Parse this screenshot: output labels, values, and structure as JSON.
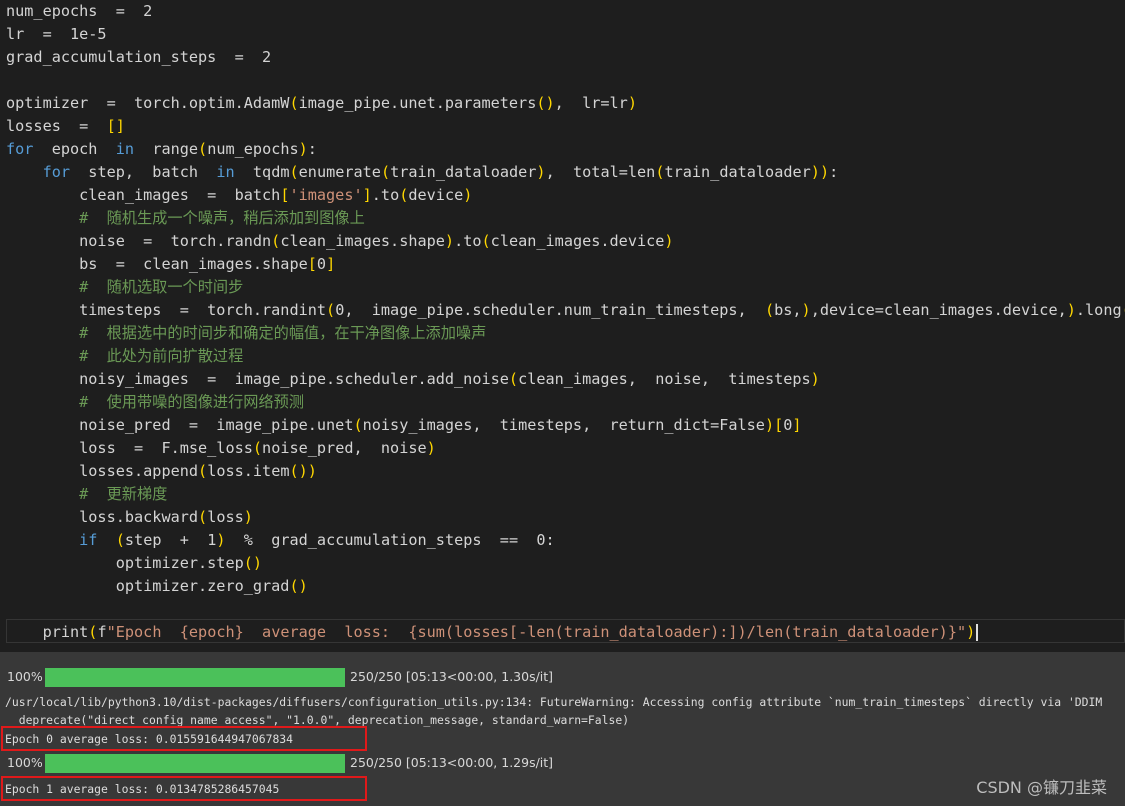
{
  "code": {
    "lines": [
      "num_epochs  =  2",
      "lr  =  1e-5",
      "grad_accumulation_steps  =  2",
      "",
      "optimizer  =  torch.optim.AdamW(image_pipe.unet.parameters(),  lr=lr)",
      "losses  =  []",
      "for  epoch  in  range(num_epochs):",
      "    for  step,  batch  in  tqdm(enumerate(train_dataloader),  total=len(train_dataloader)):",
      "        clean_images  =  batch['images'].to(device)",
      "        #  随机生成一个噪声，稍后添加到图像上",
      "        noise  =  torch.randn(clean_images.shape).to(clean_images.device)",
      "        bs  =  clean_images.shape[0]",
      "        #  随机选取一个时间步",
      "        timesteps  =  torch.randint(0,  image_pipe.scheduler.num_train_timesteps,  (bs,),device=clean_images.device,).long()",
      "        #  根据选中的时间步和确定的幅值，在干净图像上添加噪声",
      "        #  此处为前向扩散过程",
      "        noisy_images  =  image_pipe.scheduler.add_noise(clean_images,  noise,  timesteps)",
      "        #  使用带噪的图像进行网络预测",
      "        noise_pred  =  image_pipe.unet(noisy_images,  timesteps,  return_dict=False)[0]",
      "        loss  =  F.mse_loss(noise_pred,  noise)",
      "        losses.append(loss.item())",
      "        #  更新梯度",
      "        loss.backward(loss)",
      "        if  (step  +  1)  %  grad_accumulation_steps  ==  0:",
      "            optimizer.step()",
      "            optimizer.zero_grad()",
      "",
      "    print(f\"Epoch  {epoch}  average  loss:  {sum(losses[-len(train_dataloader):])/len(train_dataloader)}\")"
    ]
  },
  "output": {
    "progress_1": {
      "percent_label": "100%",
      "fraction": 1.0,
      "stats": "250/250 [05:13<00:00, 1.30s/it]"
    },
    "warning_line_1": "/usr/local/lib/python3.10/dist-packages/diffusers/configuration_utils.py:134: FutureWarning: Accessing config attribute `num_train_timesteps` directly via 'DDIM",
    "warning_line_2": "  deprecate(\"direct config name access\", \"1.0.0\", deprecation_message, standard_warn=False)",
    "epoch_0": "Epoch 0 average loss: 0.015591644947067834",
    "progress_2": {
      "percent_label": "100%",
      "fraction": 1.0,
      "stats": "250/250 [05:13<00:00, 1.29s/it]"
    },
    "epoch_1": "Epoch 1 average loss: 0.0134785286457045"
  },
  "watermark": "CSDN @镰刀韭菜",
  "colors": {
    "editor_bg": "#1e1e1e",
    "output_bg": "#383838",
    "progress_fill": "#4bc15a",
    "highlight_box": "#e0191a",
    "keyword": "#569cd6",
    "string": "#ce9178",
    "comment": "#6a9955"
  }
}
